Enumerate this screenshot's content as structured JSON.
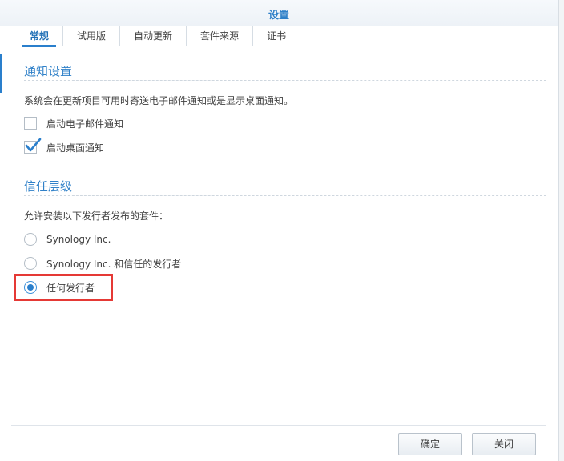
{
  "window": {
    "title": "设置"
  },
  "tabs": [
    {
      "label": "常规",
      "active": true
    },
    {
      "label": "试用版",
      "active": false
    },
    {
      "label": "自动更新",
      "active": false
    },
    {
      "label": "套件来源",
      "active": false
    },
    {
      "label": "证书",
      "active": false
    }
  ],
  "notification": {
    "title": "通知设置",
    "description": "系统会在更新项目可用时寄送电子邮件通知或是显示桌面通知。",
    "email_label": "启动电子邮件通知",
    "email_checked": false,
    "desktop_label": "启动桌面通知",
    "desktop_checked": true
  },
  "trust": {
    "title": "信任层级",
    "description": "允许安装以下发行者发布的套件：",
    "options": [
      {
        "label": "Synology Inc.",
        "selected": false
      },
      {
        "label": "Synology Inc. 和信任的发行者",
        "selected": false
      },
      {
        "label": "任何发行者",
        "selected": true
      }
    ]
  },
  "footer": {
    "ok_label": "确定",
    "close_label": "关闭"
  },
  "colors": {
    "accent": "#2a7fcc",
    "highlight": "#e53935"
  }
}
